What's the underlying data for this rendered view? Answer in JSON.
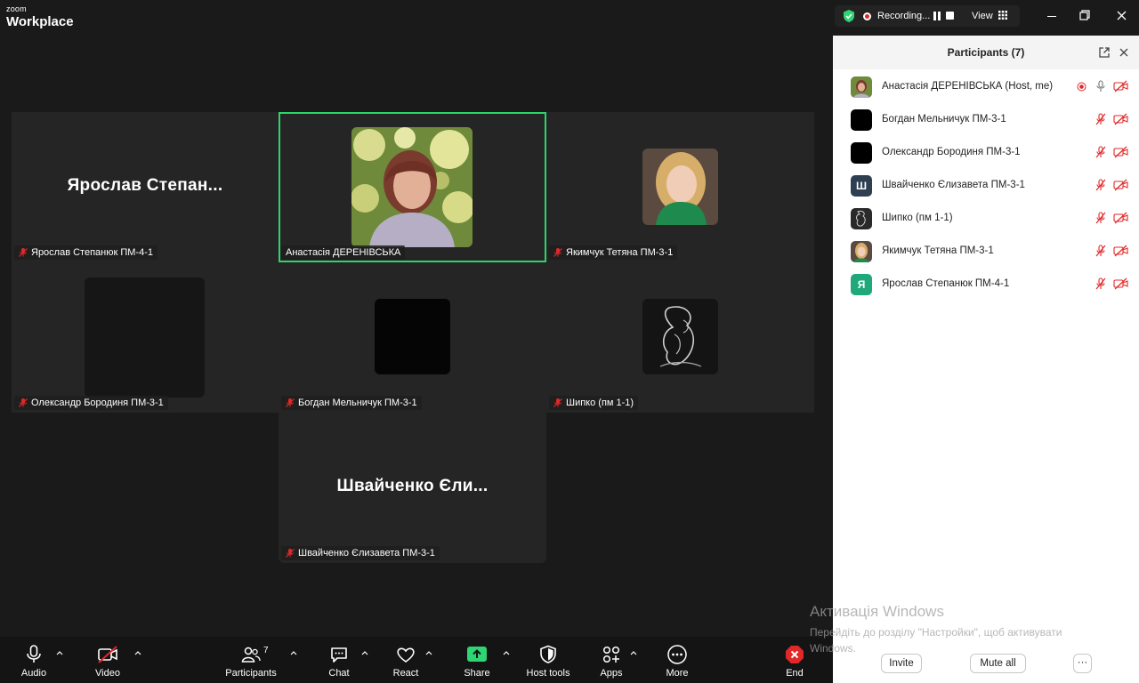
{
  "titlebar": {
    "brand_top": "zoom",
    "brand_main": "Workplace",
    "recording_label": "Recording...",
    "view_label": "View"
  },
  "tiles": [
    {
      "id": "yaroslav",
      "big_name": "Ярослав  Степан...",
      "nameplate": "Ярослав Степанюк ПМ-4-1",
      "muted": true
    },
    {
      "id": "anastasia",
      "big_name": "",
      "nameplate": "Анастасія ДЕРЕНІВСЬКА",
      "muted": false,
      "active": true
    },
    {
      "id": "yakimchuk",
      "big_name": "",
      "nameplate": "Якимчук Тетяна ПМ-3-1",
      "muted": true
    },
    {
      "id": "oleksandr",
      "big_name": "",
      "nameplate": "Олександр Бородиня ПМ-3-1",
      "muted": true
    },
    {
      "id": "bohdan",
      "big_name": "",
      "nameplate": "Богдан Мельничук ПМ-3-1",
      "muted": true
    },
    {
      "id": "shypko",
      "big_name": "",
      "nameplate": "Шипко (пм 1-1)",
      "muted": true
    },
    {
      "id": "shvaichenko",
      "big_name": "Швайченко Єли...",
      "nameplate": "Швайченко Єлизавета ПМ-3-1",
      "muted": true
    }
  ],
  "toolbar": {
    "audio": "Audio",
    "video": "Video",
    "participants": "Participants",
    "participants_count": "7",
    "chat": "Chat",
    "react": "React",
    "share": "Share",
    "host_tools": "Host tools",
    "apps": "Apps",
    "more": "More",
    "end": "End"
  },
  "panel": {
    "title": "Participants (7)",
    "participants": [
      {
        "name": "Анастасія ДЕРЕНІВСЬКА (Host, me)",
        "avatar": "photo-woman",
        "mic": "on",
        "recording": true
      },
      {
        "name": "Богдан Мельничук ПМ-3-1",
        "avatar": "black",
        "mic": "off"
      },
      {
        "name": "Олександр Бородиня ПМ-3-1",
        "avatar": "black",
        "mic": "off"
      },
      {
        "name": "Швайченко Єлизавета ПМ-3-1",
        "avatar": "letter",
        "letter": "Ш",
        "avatar_color": "#2e3f52",
        "mic": "off"
      },
      {
        "name": "Шипко (пм 1-1)",
        "avatar": "drawing",
        "mic": "off"
      },
      {
        "name": "Якимчук Тетяна ПМ-3-1",
        "avatar": "photo-girl",
        "mic": "off"
      },
      {
        "name": "Ярослав Степанюк ПМ-4-1",
        "avatar": "letter",
        "letter": "Я",
        "avatar_color": "#1fa87a",
        "mic": "off"
      }
    ],
    "invite": "Invite",
    "mute_all": "Mute all",
    "more": "···"
  },
  "watermark": {
    "line1": "Активація Windows",
    "line2": "Перейдіть до розділу \"Настройки\", щоб активувати Windows."
  },
  "colors": {
    "active_border": "#2dd46b",
    "muted_red": "#e02828",
    "share_green": "#2ed573",
    "end_red": "#e02828"
  }
}
